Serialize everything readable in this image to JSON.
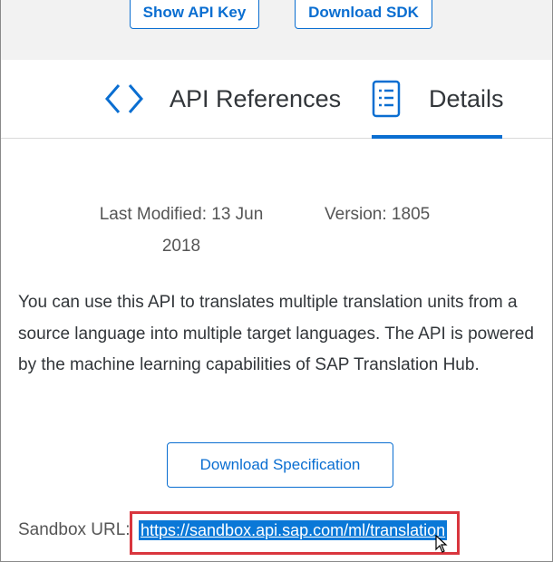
{
  "toolbar": {
    "show_api_key": "Show API Key",
    "download_sdk": "Download SDK"
  },
  "tabs": [
    {
      "label": "API References",
      "icon": "code-brackets-icon",
      "selected": false
    },
    {
      "label": "Details",
      "icon": "document-list-icon",
      "selected": true
    }
  ],
  "details": {
    "last_modified": "Last Modified: 13 Jun 2018",
    "version": "Version: 1805",
    "description": "You can use this API to translates multiple translation units from a source language into multiple target languages. The API is powered by the machine learning capabilities of SAP Translation Hub.",
    "download_spec_label": "Download Specification",
    "sandbox_label": "Sandbox URL:",
    "sandbox_url": "https://sandbox.api.sap.com/ml/translation"
  },
  "colors": {
    "accent": "#0a6ed1",
    "selection": "#0a78d7",
    "annotation_box": "#d9363e"
  }
}
